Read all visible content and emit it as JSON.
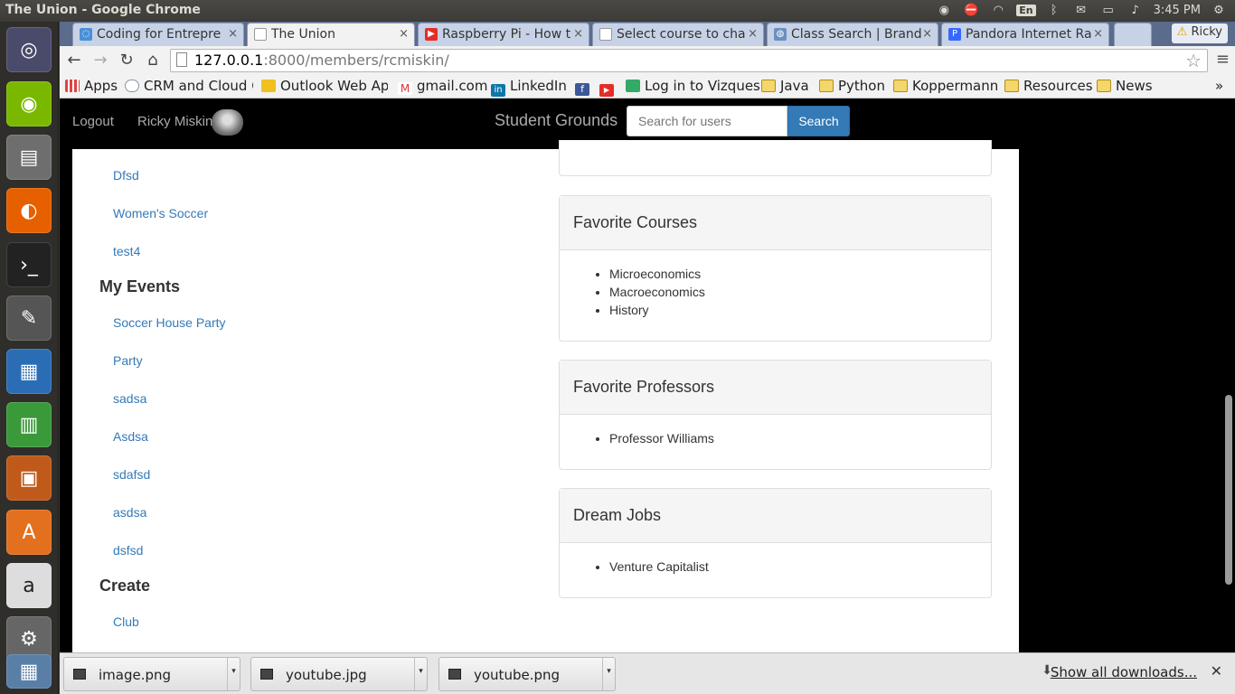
{
  "os_panel": {
    "window_title": "The Union - Google Chrome",
    "lang": "En",
    "time": "3:45 PM"
  },
  "launcher": {
    "items": [
      "ubuntu-dash",
      "chrome",
      "files",
      "firefox",
      "terminal",
      "text-editor",
      "writer",
      "calc",
      "impress",
      "software-center",
      "amazon",
      "settings",
      "workspaces"
    ]
  },
  "browser": {
    "tabs": [
      {
        "title": "Coding for Entrepre",
        "icon": "coding-favicon",
        "color": "#4a90d9"
      },
      {
        "title": "The Union",
        "icon": "page-favicon",
        "color": "#ffffff"
      },
      {
        "title": "Raspberry Pi - How t",
        "icon": "youtube-favicon",
        "color": "#e52d27"
      },
      {
        "title": "Select course to cha",
        "icon": "page-favicon",
        "color": "#ffffff"
      },
      {
        "title": "Class Search | Brand",
        "icon": "globe-favicon",
        "color": "#6d8fbf"
      },
      {
        "title": "Pandora Internet Ra",
        "icon": "pandora-favicon",
        "color": "#3668ff"
      }
    ],
    "profile_name": "Ricky",
    "url_host": "127.0.0.1",
    "url_path": ":8000/members/rcmiskin/",
    "bookmarks": [
      {
        "label": "Apps",
        "icon": "apps-grid-icon"
      },
      {
        "label": "CRM and Cloud Co",
        "icon": "salesforce-icon"
      },
      {
        "label": "Outlook Web App",
        "icon": "outlook-icon"
      },
      {
        "label": "gmail.com",
        "icon": "gmail-icon"
      },
      {
        "label": "LinkedIn",
        "icon": "linkedin-icon"
      },
      {
        "label": "",
        "icon": "facebook-icon"
      },
      {
        "label": "",
        "icon": "youtube-icon"
      },
      {
        "label": "Log in to Vizques",
        "icon": "vizque-icon"
      },
      {
        "label": "Java",
        "icon": "folder-icon"
      },
      {
        "label": "Python",
        "icon": "folder-icon"
      },
      {
        "label": "Koppermann",
        "icon": "folder-icon"
      },
      {
        "label": "Resources",
        "icon": "folder-icon"
      },
      {
        "label": "News",
        "icon": "folder-icon"
      }
    ],
    "more_bookmarks": "»"
  },
  "site": {
    "nav": {
      "logout": "Logout",
      "user_name": "Ricky Miskin",
      "brand": "Student Grounds",
      "search_placeholder": "Search for users",
      "search_button": "Search"
    },
    "sidebar": {
      "clubs": [
        "Dfsd",
        "Women's Soccer",
        "test4"
      ],
      "events_heading": "My Events",
      "events": [
        "Soccer House Party",
        "Party",
        "sadsa",
        "Asdsa",
        "sdafsd",
        "asdsa",
        "dsfsd"
      ],
      "create_heading": "Create",
      "create_items": [
        "Club"
      ]
    },
    "panels": {
      "favorite_courses": {
        "title": "Favorite Courses",
        "items": [
          "Microeconomics",
          "Macroeconomics",
          "History"
        ]
      },
      "favorite_professors": {
        "title": "Favorite Professors",
        "items": [
          "Professor Williams"
        ]
      },
      "dream_jobs": {
        "title": "Dream Jobs",
        "items": [
          "Venture Capitalist"
        ]
      }
    }
  },
  "downloads": {
    "items": [
      "image.png",
      "youtube.jpg",
      "youtube.png"
    ],
    "show_all": "Show all downloads..."
  }
}
